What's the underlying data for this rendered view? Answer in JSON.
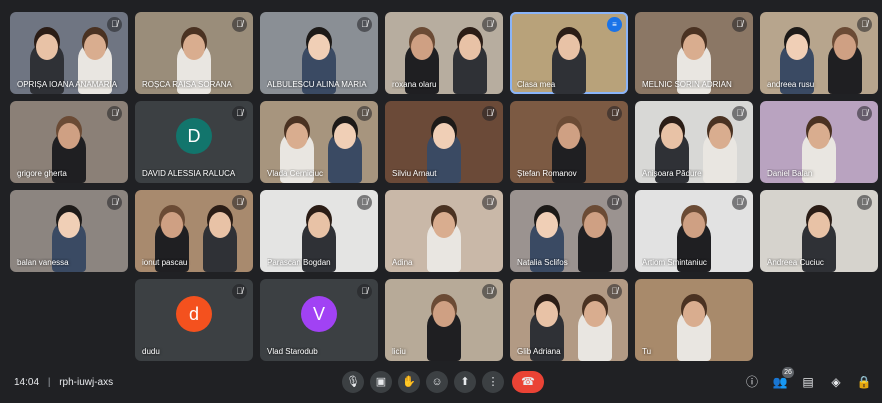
{
  "participants": [
    {
      "name": "OPRIȘA IOANA ANAMARIA",
      "muted": true,
      "bg": "#6f7582",
      "avatar": null
    },
    {
      "name": "ROȘCA RAISA SORANA",
      "muted": true,
      "bg": "#9a8d7a",
      "avatar": null
    },
    {
      "name": "ALBULESCU ALINA MARIA",
      "muted": true,
      "bg": "#8a8f95",
      "avatar": null
    },
    {
      "name": "roxana olaru",
      "muted": true,
      "bg": "#b7ad9f",
      "avatar": null
    },
    {
      "name": "Clasa mea",
      "muted": false,
      "speaking": true,
      "bg": "#b8a27a",
      "avatar": null
    },
    {
      "name": "MELNIC SORIN ADRIAN",
      "muted": true,
      "bg": "#8b7765",
      "avatar": null
    },
    {
      "name": "andreea rusu",
      "muted": true,
      "bg": "#b7a58d",
      "avatar": null
    },
    {
      "name": "grigore gherta",
      "muted": true,
      "bg": "#8b8077",
      "avatar": null
    },
    {
      "name": "DAVID ALESSIA RALUCA",
      "muted": true,
      "bg": "#3c4043",
      "avatar": {
        "letter": "D",
        "color": "#12756c"
      }
    },
    {
      "name": "Vlada Cerniciuc",
      "muted": true,
      "bg": "#a7957e",
      "avatar": null
    },
    {
      "name": "Silviu Arnaut",
      "muted": true,
      "bg": "#6b4a38",
      "avatar": null
    },
    {
      "name": "Ștefan Romanov",
      "muted": true,
      "bg": "#7c5a43",
      "avatar": null
    },
    {
      "name": "Anișoara Pădure",
      "muted": true,
      "bg": "#d8d8d6",
      "avatar": null
    },
    {
      "name": "Daniel Balan",
      "muted": true,
      "bg": "#b9a3c0",
      "avatar": null
    },
    {
      "name": "balan vanessa",
      "muted": true,
      "bg": "#8c8580",
      "avatar": null
    },
    {
      "name": "ionut pascau",
      "muted": true,
      "bg": "#a88a6e",
      "avatar": null
    },
    {
      "name": "Parascan Bogdan",
      "muted": true,
      "bg": "#e4e4e3",
      "avatar": null
    },
    {
      "name": "Adina",
      "muted": true,
      "bg": "#c9b8a8",
      "avatar": null
    },
    {
      "name": "Natalia Sclifos",
      "muted": true,
      "bg": "#9b9390",
      "avatar": null
    },
    {
      "name": "Artiom Smintaniuc",
      "muted": true,
      "bg": "#e2e2e2",
      "avatar": null
    },
    {
      "name": "Andreea Cuciuc",
      "muted": true,
      "bg": "#d6d3cd",
      "avatar": null
    },
    {
      "name": "dudu",
      "muted": true,
      "bg": "#3c4043",
      "avatar": {
        "letter": "d",
        "color": "#f4511e"
      }
    },
    {
      "name": "Vlad Starodub",
      "muted": true,
      "bg": "#3c4043",
      "avatar": {
        "letter": "V",
        "color": "#a142f4"
      }
    },
    {
      "name": "liciu",
      "muted": true,
      "bg": "#b7aa98",
      "avatar": null
    },
    {
      "name": "Glib Adriana",
      "muted": true,
      "bg": "#b29a84",
      "avatar": null
    },
    {
      "name": "Tu",
      "muted": false,
      "bg": "#a88a6b",
      "avatar": null
    }
  ],
  "bottom_bar": {
    "time": "14:04",
    "separator": "|",
    "meeting_code": "rph-iuwj-axs",
    "controls": [
      {
        "name": "microphone-button",
        "icon": "🎙"
      },
      {
        "name": "camera-button",
        "icon": "▣"
      },
      {
        "name": "raise-hand-button",
        "icon": "✋"
      },
      {
        "name": "emoji-button",
        "icon": "☺"
      },
      {
        "name": "present-button",
        "icon": "⬆"
      },
      {
        "name": "more-options-button",
        "icon": "⋮"
      }
    ],
    "hangup_icon": "☎",
    "right": [
      {
        "name": "meeting-details-button",
        "icon": "ⓘ"
      },
      {
        "name": "people-button",
        "icon": "👥",
        "badge": "26"
      },
      {
        "name": "chat-button",
        "icon": "▤"
      },
      {
        "name": "activities-button",
        "icon": "◈"
      },
      {
        "name": "host-controls-button",
        "icon": "🔒"
      }
    ]
  }
}
